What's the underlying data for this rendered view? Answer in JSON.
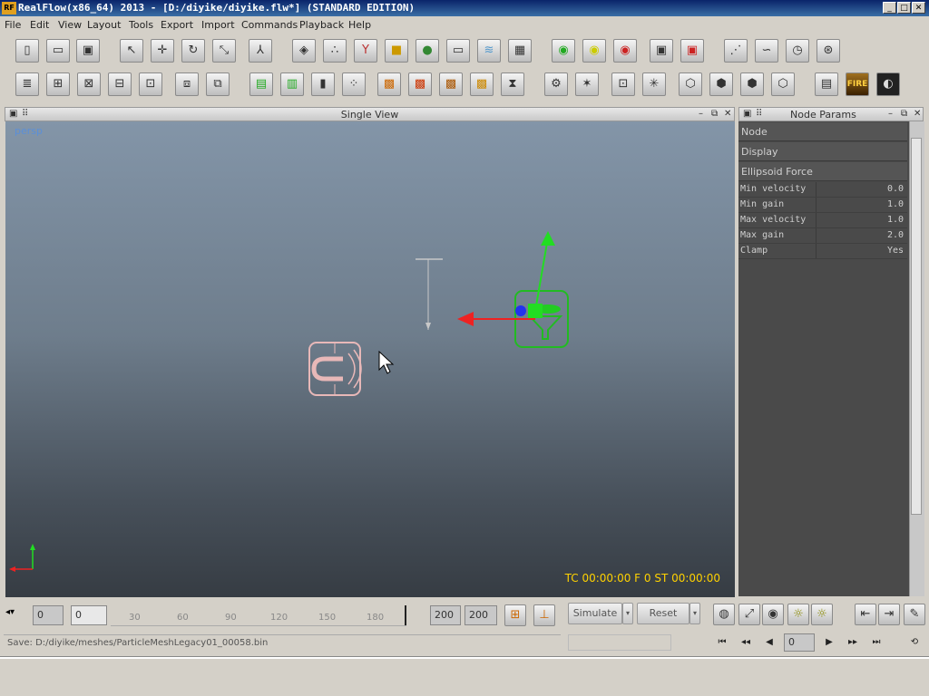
{
  "window": {
    "logo": "RF",
    "title": "RealFlow(x86_64) 2013 - [D:/diyike/diyike.flw*] (STANDARD EDITION)",
    "minimize": "_",
    "maximize": "□",
    "close": "✕"
  },
  "menu": [
    "File",
    "Edit",
    "View",
    "Layout",
    "Tools",
    "Export",
    "Import",
    "Commands",
    "Playback",
    "Help"
  ],
  "toolbar1_icons": [
    "new-file-icon",
    "open-file-icon",
    "save-icon",
    "select-icon",
    "move-icon",
    "rotate-icon",
    "scale-icon",
    "axis-icon",
    "layer-icon",
    "particles-icon",
    "daemon-icon",
    "cube-icon",
    "mesh-icon",
    "camera-icon",
    "wave-icon",
    "grid-object-icon",
    "green-light-icon",
    "yellow-light-icon",
    "red-light-icon",
    "save-cache-icon",
    "delete-cache-icon",
    "export-script-icon",
    "batch-icon",
    "timer-icon",
    "network-icon"
  ],
  "toolbar2_icons": [
    "list-icon",
    "link-add-icon",
    "link-check-icon",
    "link-remove-icon",
    "link-refresh-icon",
    "box-icon",
    "box-open-icon",
    "export-icon",
    "film-icon",
    "ruler-icon",
    "dots-icon",
    "texture1-icon",
    "texture2-icon",
    "texture3-icon",
    "texture4-icon",
    "hourglass-icon",
    "gear-box-icon",
    "spark-icon",
    "box-select-icon",
    "box-burst-icon",
    "wire-cube-icon",
    "cube-outline-icon",
    "cube-solid-icon",
    "cube-light-icon",
    "stack-icon",
    "fire-icon",
    "dark-render-icon"
  ],
  "fire_label": "FIRE",
  "viewport": {
    "header": "Single View",
    "camera": "persp",
    "readout": "TC 00:00:00   F 0   ST 00:00:00"
  },
  "node_params": {
    "header": "Node Params",
    "sections": [
      "Node",
      "Display",
      "Ellipsoid Force"
    ],
    "params": [
      {
        "name": "Min velocity",
        "value": "0.0"
      },
      {
        "name": "Min gain",
        "value": "1.0"
      },
      {
        "name": "Max velocity",
        "value": "1.0"
      },
      {
        "name": "Max gain",
        "value": "2.0"
      },
      {
        "name": "Clamp",
        "value": "Yes"
      }
    ]
  },
  "timeline": {
    "start": "0",
    "current": "0",
    "ticks": [
      "30",
      "60",
      "90",
      "120",
      "150",
      "180"
    ],
    "end1": "200",
    "end2": "200",
    "simulate": "Simulate",
    "reset": "Reset",
    "frame": "0"
  },
  "status": "Save: D:/diyike/meshes/ParticleMeshLegacy01_00058.bin"
}
